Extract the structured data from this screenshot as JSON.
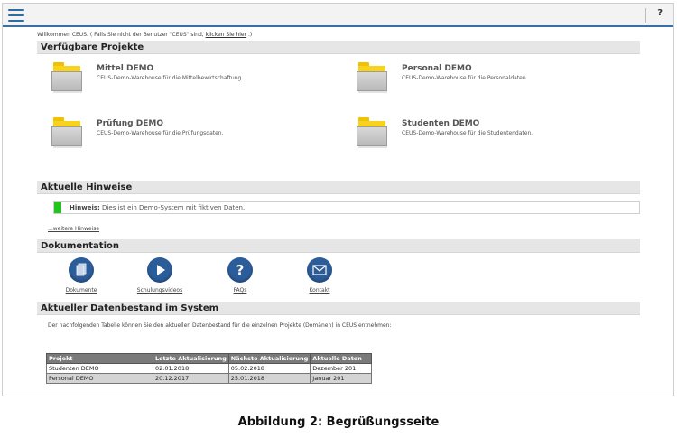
{
  "header": {
    "help_label": "?"
  },
  "welcome": {
    "prefix": "Willkommen CEUS. ( Falls Sie nicht der Benutzer \"CEUS\" sind, ",
    "link": "klicken Sie hier",
    "suffix": " .)"
  },
  "projects": {
    "title": "Verfügbare Projekte",
    "items": [
      {
        "name": "Mittel DEMO",
        "desc": "CEUS-Demo-Warehouse für die Mittelbewirtschaftung."
      },
      {
        "name": "Personal DEMO",
        "desc": "CEUS-Demo-Warehouse für die Personaldaten."
      },
      {
        "name": "Prüfung DEMO",
        "desc": "CEUS-Demo-Warehouse für die Prüfungsdaten."
      },
      {
        "name": "Studenten DEMO",
        "desc": "CEUS-Demo-Warehouse für die Studentendaten."
      }
    ]
  },
  "notices": {
    "title": "Aktuelle Hinweise",
    "label": "Hinweis:",
    "text": " Dies ist ein Demo-System mit fiktiven Daten.",
    "more": "...weitere Hinweise",
    "status_color": "#22c41e"
  },
  "docs": {
    "title": "Dokumentation",
    "items": [
      {
        "label": "Dokumente",
        "icon": "documents-icon"
      },
      {
        "label": "Schulungsvideos",
        "icon": "play-icon"
      },
      {
        "label": "FAQs",
        "icon": "question-icon"
      },
      {
        "label": "Kontakt",
        "icon": "mail-icon"
      }
    ]
  },
  "data_status": {
    "title": "Aktueller Datenbestand im System",
    "intro": "Der nachfolgenden Tabelle können Sie den aktuellen Datenbestand für die einzelnen Projekte (Domänen) in CEUS entnehmen:",
    "columns": [
      "Projekt",
      "Letzte Aktualisierung",
      "Nächste Aktualisierung",
      "Aktuelle Daten"
    ],
    "rows": [
      [
        "Studenten DEMO",
        "02.01.2018",
        "05.02.2018",
        "Dezember 201"
      ],
      [
        "Personal DEMO",
        "20.12.2017",
        "25.01.2018",
        "Januar 201"
      ]
    ]
  },
  "caption": "Abbildung 2: Begrüßungsseite",
  "colors": {
    "accent": "#2e6da4",
    "icon_blue": "#2c5d9b",
    "folder": "#f7d31e"
  }
}
